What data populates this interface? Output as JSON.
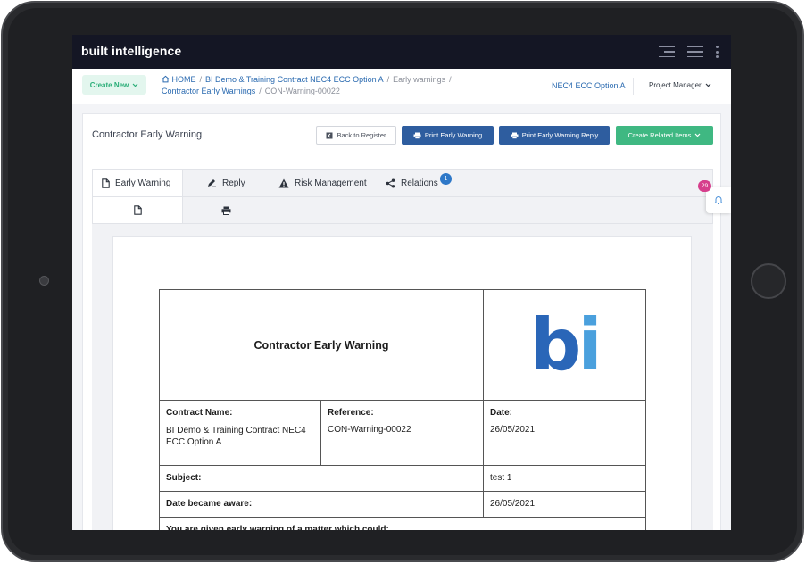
{
  "app": {
    "brand": "built intelligence"
  },
  "subbar": {
    "create_new": "Create New",
    "breadcrumb": {
      "home": "HOME",
      "contract": "BI Demo & Training Contract NEC4 ECC Option A",
      "section": "Early warnings",
      "register": "Contractor Early Warnings",
      "current": "CON-Warning-00022"
    },
    "contract_option": "NEC4 ECC Option A",
    "role": "Project Manager"
  },
  "page": {
    "title": "Contractor Early Warning",
    "buttons": {
      "back": "Back to Register",
      "print_warning": "Print Early Warning",
      "print_reply": "Print Early Warning Reply",
      "related": "Create Related Items"
    }
  },
  "tabs": [
    {
      "label": "Early Warning",
      "icon": "document-icon"
    },
    {
      "label": "Reply",
      "icon": "pencil-icon"
    },
    {
      "label": "Risk Management",
      "icon": "warning-icon"
    },
    {
      "label": "Relations",
      "icon": "share-icon",
      "badge": "1"
    }
  ],
  "subtabs": [
    {
      "icon": "document-icon"
    },
    {
      "icon": "printer-icon"
    }
  ],
  "notifications": {
    "count": "29"
  },
  "document": {
    "title": "Contractor Early Warning",
    "logo": {
      "b": "b",
      "i": "i"
    },
    "contract_name_label": "Contract Name:",
    "contract_name_value": "BI Demo & Training Contract NEC4 ECC Option A",
    "reference_label": "Reference:",
    "reference_value": "CON-Warning-00022",
    "date_label": "Date:",
    "date_value": "26/05/2021",
    "subject_label": "Subject:",
    "subject_value": "test 1",
    "date_aware_label": "Date became aware:",
    "date_aware_value": "26/05/2021",
    "matter_label": "You are given early warning of a matter which could:"
  },
  "colors": {
    "appbar": "#141624",
    "primary_blue": "#2e5d9f",
    "green": "#3fb882",
    "link": "#2a6ab0",
    "logo_b": "#2a66b8",
    "logo_i": "#4aa0dd",
    "notification_badge": "#d63f8c"
  }
}
